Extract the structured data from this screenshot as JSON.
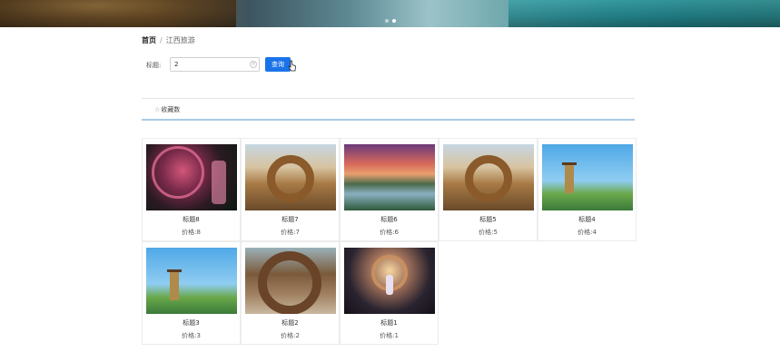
{
  "breadcrumb": {
    "home": "首页",
    "separator": "/",
    "current": "江西旅游"
  },
  "search": {
    "label": "标题:",
    "value": "2",
    "placeholder": "",
    "button_label": "查询"
  },
  "tabs": {
    "favorites_label": "收藏数"
  },
  "colors": {
    "primary_button": "#1a73e8",
    "tab_underline": "#a9cbe6"
  },
  "items": [
    {
      "title": "标题8",
      "price": "价格:8",
      "image": "lantern-deer-night"
    },
    {
      "title": "标题7",
      "price": "价格:7",
      "image": "woven-nest-arch"
    },
    {
      "title": "标题6",
      "price": "价格:6",
      "image": "river-valley-sunset"
    },
    {
      "title": "标题5",
      "price": "价格:5",
      "image": "woven-nest-arch"
    },
    {
      "title": "标题4",
      "price": "价格:4",
      "image": "pagoda-lake"
    },
    {
      "title": "标题3",
      "price": "价格:3",
      "image": "pagoda-lake"
    },
    {
      "title": "标题2",
      "price": "价格:2",
      "image": "wooden-ring-arch"
    },
    {
      "title": "标题1",
      "price": "价格:1",
      "image": "heart-swing"
    }
  ]
}
